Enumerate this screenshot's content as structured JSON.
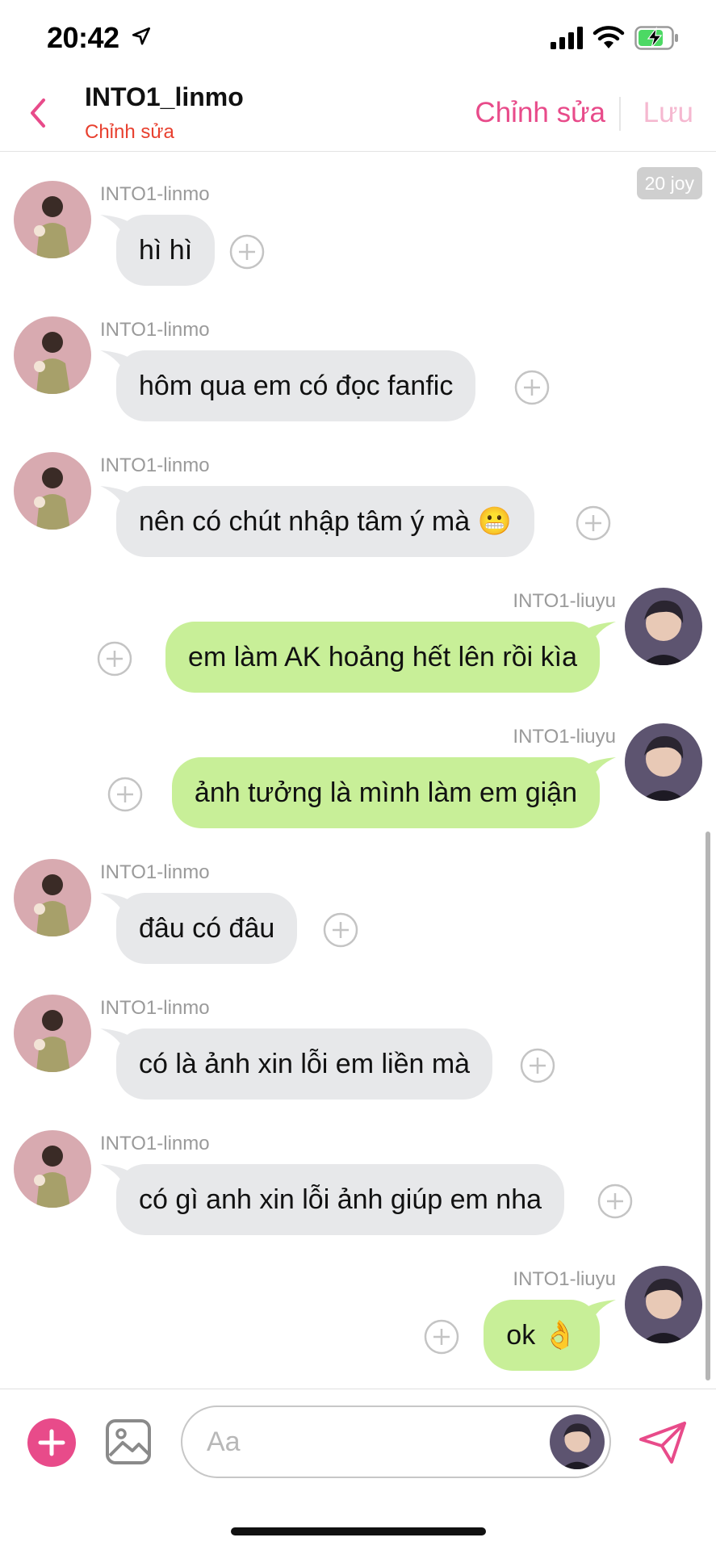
{
  "status_bar": {
    "time": "20:42"
  },
  "header": {
    "title": "INTO1_linmo",
    "subtitle": "Chỉnh sửa",
    "edit_label": "Chỉnh sửa",
    "save_label": "Lưu"
  },
  "timestamp_badge": "20 joy",
  "messages": [
    {
      "sender": "INTO1-linmo",
      "text": "hì hì",
      "side": "in"
    },
    {
      "sender": "INTO1-linmo",
      "text": "hôm qua em có đọc fanfic",
      "side": "in"
    },
    {
      "sender": "INTO1-linmo",
      "text": "nên có chút nhập tâm ý mà 😬",
      "side": "in"
    },
    {
      "sender": "INTO1-liuyu",
      "text": "em làm AK hoảng hết lên rồi kìa",
      "side": "out"
    },
    {
      "sender": "INTO1-liuyu",
      "text": "ảnh tưởng là mình làm em giận",
      "side": "out"
    },
    {
      "sender": "INTO1-linmo",
      "text": "đâu có đâu",
      "side": "in"
    },
    {
      "sender": "INTO1-linmo",
      "text": "có là ảnh xin lỗi em liền mà",
      "side": "in"
    },
    {
      "sender": "INTO1-linmo",
      "text": "có gì anh xin lỗi ảnh giúp em nha",
      "side": "in"
    },
    {
      "sender": "INTO1-liuyu",
      "text": "ok 👌",
      "side": "out"
    }
  ],
  "composer": {
    "placeholder": "Aa"
  },
  "colors": {
    "accent_pink": "#e84b8a",
    "subtitle_red": "#e8402f",
    "incoming_bubble": "#e7e8ea",
    "outgoing_bubble": "#c8ef98"
  }
}
